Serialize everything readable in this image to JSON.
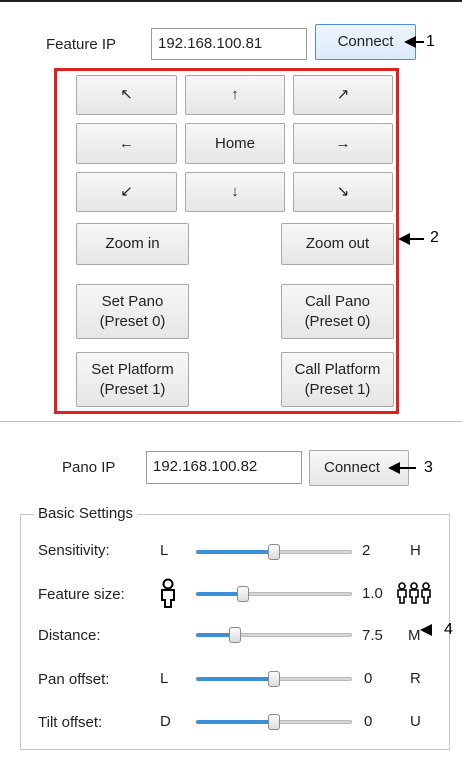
{
  "feature": {
    "ip_label": "Feature IP",
    "ip_value": "192.168.100.81",
    "connect_label": "Connect"
  },
  "ptz": {
    "up_left": "↖",
    "up": "↑",
    "up_right": "↗",
    "left": "←",
    "home": "Home",
    "right": "→",
    "down_left": "↙",
    "down": "↓",
    "down_right": "↘",
    "zoom_in": "Zoom in",
    "zoom_out": "Zoom out",
    "set_pano_1": "Set Pano",
    "set_pano_2": "(Preset 0)",
    "call_pano_1": "Call Pano",
    "call_pano_2": "(Preset 0)",
    "set_platform_1": "Set Platform",
    "set_platform_2": "(Preset 1)",
    "call_platform_1": "Call Platform",
    "call_platform_2": "(Preset 1)"
  },
  "pano": {
    "ip_label": "Pano IP",
    "ip_value": "192.168.100.82",
    "connect_label": "Connect"
  },
  "basic": {
    "title": "Basic Settings",
    "sensitivity": {
      "label": "Sensitivity:",
      "left": "L",
      "value": "2",
      "right": "H",
      "level": 0.5
    },
    "feature_size": {
      "label": "Feature size:",
      "left_icon": "single-person-icon",
      "value": "1.0",
      "right_icon": "group-people-icon",
      "level": 0.3
    },
    "distance": {
      "label": "Distance:",
      "left": "",
      "value": "7.5",
      "right": "M",
      "level": 0.25
    },
    "pan_offset": {
      "label": "Pan offset:",
      "left": "L",
      "value": "0",
      "right": "R",
      "level": 0.5
    },
    "tilt_offset": {
      "label": "Tilt offset:",
      "left": "D",
      "value": "0",
      "right": "U",
      "level": 0.5
    }
  },
  "annotations": {
    "a1": "1",
    "a2": "2",
    "a3": "3",
    "a4": "4"
  },
  "colors": {
    "highlight_box": "#e02020",
    "slider_fill": "#3d8fd6",
    "connect_border": "#4a90d9"
  }
}
